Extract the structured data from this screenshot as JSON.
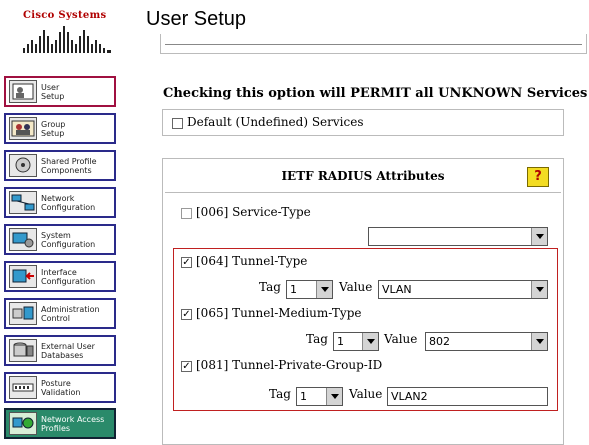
{
  "brand": {
    "name": "Cisco Systems"
  },
  "page": {
    "title": "User Setup"
  },
  "nav": {
    "items": [
      {
        "label": "User\nSetup",
        "icon": "user-icon"
      },
      {
        "label": "Group\nSetup",
        "icon": "group-icon"
      },
      {
        "label": "Shared Profile\nComponents",
        "icon": "components-icon"
      },
      {
        "label": "Network\nConfiguration",
        "icon": "network-icon"
      },
      {
        "label": "System\nConfiguration",
        "icon": "system-icon"
      },
      {
        "label": "Interface\nConfiguration",
        "icon": "interface-icon"
      },
      {
        "label": "Administration\nControl",
        "icon": "admin-icon"
      },
      {
        "label": "External User\nDatabases",
        "icon": "database-icon"
      },
      {
        "label": "Posture\nValidation",
        "icon": "posture-icon"
      },
      {
        "label": "Network Access\nProfiles",
        "icon": "profiles-icon"
      }
    ]
  },
  "main": {
    "permit_note": "Checking this option will PERMIT all UNKNOWN Services",
    "default_services": {
      "label": "Default (Undefined) Services",
      "checked": false
    },
    "radius": {
      "title": "IETF RADIUS Attributes",
      "help_label": "?",
      "service_type": {
        "label": "[006] Service-Type",
        "checked": false,
        "value": ""
      },
      "tag_label": "Tag",
      "value_label": "Value",
      "tunnel_type": {
        "label": "[064] Tunnel-Type",
        "checked": true,
        "tag": "1",
        "value": "VLAN"
      },
      "tunnel_medium": {
        "label": "[065] Tunnel-Medium-Type",
        "checked": true,
        "tag": "1",
        "value": "802"
      },
      "tunnel_group": {
        "label": "[081] Tunnel-Private-Group-ID",
        "checked": true,
        "tag": "1",
        "value": "VLAN2"
      }
    }
  }
}
